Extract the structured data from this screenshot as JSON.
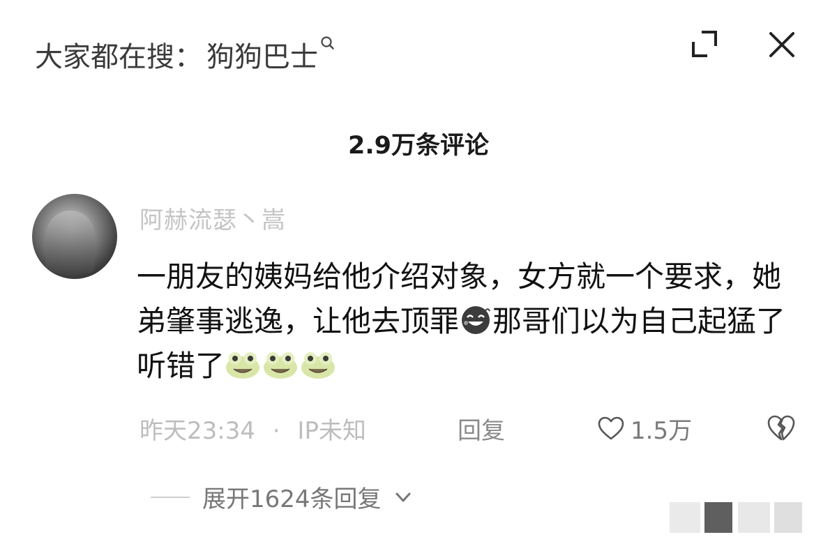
{
  "header": {
    "search_hint_prefix": "大家都在搜：",
    "search_hint_query": "狗狗巴士",
    "icons": [
      "expand-icon",
      "close-icon",
      "search-icon"
    ]
  },
  "comments_count_label": "2.9万条评论",
  "comment": {
    "username": "阿赫流瑟丶嵩",
    "text_part1": "一朋友的姨妈给他介绍对象，女方就一个要求，她弟肇事逃逸，让他去顶罪",
    "text_part2": "那哥们以为自己起猛了听错了",
    "emoji_after_part1": "laugh-cry-emoji",
    "emoji_after_part2": [
      "frog-emoji",
      "frog-emoji",
      "frog-emoji"
    ],
    "timestamp": "昨天23:34",
    "separator": "·",
    "ip_location": "IP未知",
    "reply_label": "回复",
    "like_count": "1.5万",
    "expand_replies_label": "展开1624条回复"
  },
  "colors": {
    "text_primary": "#111111",
    "text_muted": "#bdbdbd",
    "background": "#ffffff"
  }
}
